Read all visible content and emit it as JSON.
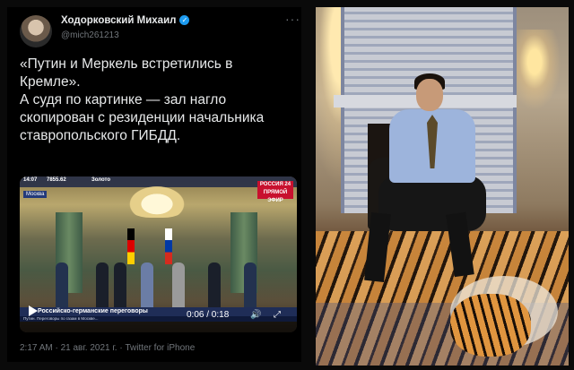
{
  "tweet": {
    "author_name": "Ходорковский Михаил",
    "verified_mark": "✓",
    "handle": "@mich261213",
    "more_icon": "···",
    "text_lines": [
      "«Путин и Меркель встретились в Кремле».",
      "А судя по картинке — зал нагло скопирован с резиденции начальника ставропольского ГИБДД."
    ],
    "meta": "2:17 AM · 21 авг. 2021 г. · Twitter for iPhone"
  },
  "video": {
    "top_time": "14:07",
    "top_ticker": "7855.62",
    "top_label": "Золото",
    "channel_logo": "РОССИЯ 24",
    "channel_sub": "ПРЯМОЙ ЭФИР",
    "location": "Москва",
    "caption": "Российско-германские переговоры",
    "ticker": "Путин. Переговоры по газам в Москве...",
    "time_display": "0:06 / 0:18",
    "volume_icon": "🔊",
    "fullscreen_icon": "⤢",
    "colors": {
      "brand_red": "#c8102e",
      "bar_blue": "#1f2d57"
    }
  }
}
